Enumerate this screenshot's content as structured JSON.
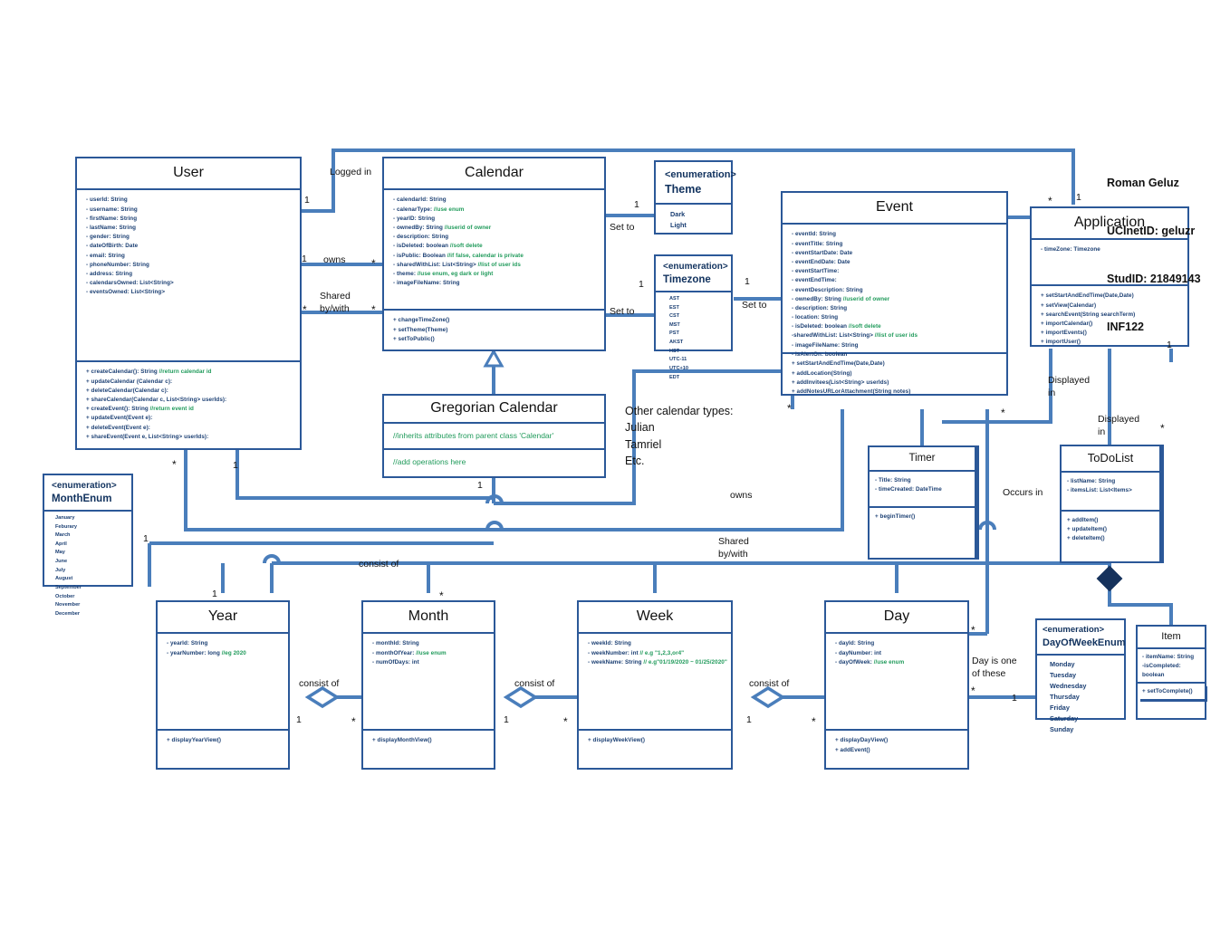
{
  "author": {
    "name": "Roman Geluz",
    "ucinetid": "UCInetID: geluzr",
    "studid": "StudID: 21849143",
    "course": "INF122"
  },
  "classes": {
    "user": {
      "name": "User",
      "attributes": [
        {
          "text": "- userId: String"
        },
        {
          "text": "- username: String"
        },
        {
          "text": "- firstName: String"
        },
        {
          "text": "- lastName: String"
        },
        {
          "text": "- gender: String"
        },
        {
          "text": "- dateOfBirth: Date"
        },
        {
          "text": "- email: String"
        },
        {
          "text": "- phoneNumber: String"
        },
        {
          "text": "- address: String"
        },
        {
          "text": "- calendarsOwned: List<String>"
        },
        {
          "text": "- eventsOwned: List<String>"
        }
      ],
      "operations": [
        {
          "text": "+ createCalendar(): String ",
          "comment": "//return calendar id"
        },
        {
          "text": "+ updateCalendar (Calendar c):",
          "comment": ""
        },
        {
          "text": "+ deleteCalendar(Calendar c):",
          "comment": ""
        },
        {
          "text": "+ shareCalendar(Calendar c, List<String> userIds):",
          "comment": ""
        },
        {
          "text": "+ createEvent(): String ",
          "comment": "//return event id"
        },
        {
          "text": "+ updateEvent(Event e):",
          "comment": ""
        },
        {
          "text": "+ deleteEvent(Event e):",
          "comment": ""
        },
        {
          "text": "+ shareEvent(Event e, List<String> userIds):",
          "comment": ""
        }
      ]
    },
    "calendar": {
      "name": "Calendar",
      "attributes": [
        {
          "text": "- calendarId: String",
          "comment": ""
        },
        {
          "text": "- calenarType: ",
          "comment": "//use enum"
        },
        {
          "text": "- yearID: String",
          "comment": ""
        },
        {
          "text": "- ownedBy: String ",
          "comment": "//userid of owner"
        },
        {
          "text": "- description: String",
          "comment": ""
        },
        {
          "text": "- isDeleted: boolean ",
          "comment": "//soft delete"
        },
        {
          "text": "- isPublic: Boolean ",
          "comment": "//if false, calendar is private"
        },
        {
          "text": "- sharedWithList: List<String> ",
          "comment": "//list of user ids"
        },
        {
          "text": "- theme: ",
          "comment": "//use enum, eg dark or light"
        },
        {
          "text": "- imageFileName: String",
          "comment": ""
        }
      ],
      "operations": [
        {
          "text": "+ changeTimeZone()",
          "comment": ""
        },
        {
          "text": "+ setTheme(Theme)",
          "comment": ""
        },
        {
          "text": "+ setToPublic()",
          "comment": ""
        }
      ]
    },
    "gregorian_calendar": {
      "name": "Gregorian Calendar",
      "attributes_note": "//inherits attributes from parent class 'Calendar'",
      "operations_note": "//add operations here"
    },
    "event": {
      "name": "Event",
      "attributes": [
        {
          "text": "- eventId: String",
          "comment": ""
        },
        {
          "text": "- eventTitle: String",
          "comment": ""
        },
        {
          "text": "- eventStartDate: Date",
          "comment": ""
        },
        {
          "text": "- eventEndDate: Date",
          "comment": ""
        },
        {
          "text": "- eventStartTime:",
          "comment": ""
        },
        {
          "text": "- eventEndTime:",
          "comment": ""
        },
        {
          "text": "- eventDescription: String",
          "comment": ""
        },
        {
          "text": "- ownedBy: String ",
          "comment": "//userid of owner"
        },
        {
          "text": "- description: String",
          "comment": ""
        },
        {
          "text": "- location: String",
          "comment": ""
        },
        {
          "text": "- isDeleted: boolean ",
          "comment": "//soft delete"
        },
        {
          "text": "-sharedWithList: List<String> ",
          "comment": "//list of user ids"
        },
        {
          "text": "- imageFileName: String",
          "comment": ""
        },
        {
          "text": "- isAlertOn: boolean",
          "comment": ""
        }
      ],
      "operations": [
        {
          "text": "+ setStartAndEndTime(Date,Date)",
          "comment": ""
        },
        {
          "text": "+ addLocation(String)",
          "comment": ""
        },
        {
          "text": "+ addInvitees(List<String> userIds)",
          "comment": ""
        },
        {
          "text": "+ addNotesURLorAttachment(String notes)",
          "comment": ""
        }
      ]
    },
    "application": {
      "name": "Application",
      "attributes": [
        {
          "text": "- timeZone: Timezone",
          "comment": ""
        }
      ],
      "operations": [
        {
          "text": "+ setStartAndEndTime(Date,Date)",
          "comment": ""
        },
        {
          "text": "+ setView(Calendar)",
          "comment": ""
        },
        {
          "text": "+ searchEvent(String searchTerm)",
          "comment": ""
        },
        {
          "text": "+ importCalendar()",
          "comment": ""
        },
        {
          "text": "+ importEvents()",
          "comment": ""
        },
        {
          "text": "+ importUser()",
          "comment": ""
        }
      ]
    },
    "timer": {
      "name": "Timer",
      "attributes": [
        {
          "text": "- Title: String",
          "comment": ""
        },
        {
          "text": "- timeCreated: DateTime",
          "comment": ""
        }
      ],
      "operations": [
        {
          "text": "+ beginTimer()",
          "comment": ""
        }
      ]
    },
    "todolist": {
      "name": "ToDoList",
      "attributes": [
        {
          "text": "- listName: String",
          "comment": ""
        },
        {
          "text": "- itemsList: List<Items>",
          "comment": ""
        }
      ],
      "operations": [
        {
          "text": "+ addItem()",
          "comment": ""
        },
        {
          "text": "+ updateItem()",
          "comment": ""
        },
        {
          "text": "+ deleteItem()",
          "comment": ""
        }
      ]
    },
    "item": {
      "name": "Item",
      "attributes": [
        {
          "text": "- itemName: String",
          "comment": ""
        },
        {
          "text": "-isCompleted:",
          "comment": ""
        },
        {
          "text": "boolean",
          "comment": ""
        }
      ],
      "operations": [
        {
          "text": "+ setToComplete()",
          "comment": ""
        }
      ]
    },
    "year": {
      "name": "Year",
      "attributes": [
        {
          "text": "- yearId: String",
          "comment": ""
        },
        {
          "text": "- yearNumber: long ",
          "comment": "//eg 2020"
        }
      ],
      "operations": [
        {
          "text": "+ displayYearView()",
          "comment": ""
        }
      ]
    },
    "month": {
      "name": "Month",
      "attributes": [
        {
          "text": "- monthId: String",
          "comment": ""
        },
        {
          "text": "- monthOfYear: ",
          "comment": "//use enum"
        },
        {
          "text": "- numOfDays: int",
          "comment": ""
        }
      ],
      "operations": [
        {
          "text": "+ displayMonthView()",
          "comment": ""
        }
      ]
    },
    "week": {
      "name": "Week",
      "attributes": [
        {
          "text": "- weekId: String",
          "comment": ""
        },
        {
          "text": "- weekNumber: int ",
          "comment": "// e.g \"1,2,3,or4\""
        },
        {
          "text": "- weekName: String ",
          "comment": "// e.g\"01/19/2020 ~ 01/25/2020\""
        }
      ],
      "operations": [
        {
          "text": "+ displayWeekView()",
          "comment": ""
        }
      ]
    },
    "day": {
      "name": "Day",
      "attributes": [
        {
          "text": "- dayId: String",
          "comment": ""
        },
        {
          "text": "- dayNumber: int",
          "comment": ""
        },
        {
          "text": "- dayOfWeek: ",
          "comment": "//use enum"
        }
      ],
      "operations": [
        {
          "text": "+ displayDayView()",
          "comment": ""
        },
        {
          "text": "+ addEvent()",
          "comment": ""
        }
      ]
    }
  },
  "enums": {
    "theme": {
      "stereotype": "<enumeration>",
      "name": "Theme",
      "values": [
        "Dark",
        "Light"
      ]
    },
    "timezone": {
      "stereotype": "<enumeration>",
      "name": "Timezone",
      "values": [
        "AST",
        "EST",
        "CST",
        "MST",
        "PST",
        "AKST",
        "HST",
        "UTC-11",
        "UTC+10",
        "EDT"
      ]
    },
    "month_enum": {
      "stereotype": "<enumeration>",
      "name": "MonthEnum",
      "values": [
        "January",
        "Feburary",
        "March",
        "April",
        "May",
        "June",
        "July",
        "August",
        "September",
        "October",
        "November",
        "December"
      ]
    },
    "day_of_week_enum": {
      "stereotype": "<enumeration>",
      "name": "DayOfWeekEnum",
      "values": [
        "Monday",
        "Tuesday",
        "Wednesday",
        "Thursday",
        "Friday",
        "Saturday",
        "Sunday"
      ]
    }
  },
  "labels": {
    "logged_in": "Logged in",
    "owns": "owns",
    "shared_by_with": "Shared\nby/with",
    "set_to_theme": "Set to",
    "set_to_timezone_left": "Set to",
    "set_to_timezone_right": "Set to",
    "owns_right": "owns",
    "shared_by_with_right": "Shared\nby/with",
    "displayed_in_1": "Displayed\nin",
    "displayed_in_2": "Displayed\nin",
    "occurs_in": "Occurs in",
    "day_is_one_of_these": "Day is one\nof these",
    "consist_of_year_month": "consist of",
    "consist_of_month_week": "consist of",
    "consist_of_week_day": "consist of",
    "consist_of_top": "consist of",
    "other_calendar_types": "Other calendar types:\nJulian\nTamriel\nEtc."
  },
  "multiplicities": {
    "user_logged_in": "1",
    "user_owns": "1",
    "calendar_owns_many": "*",
    "user_shared_many": "*",
    "calendar_shared_many": "*",
    "calendar_theme": "1",
    "calendar_tz": "1",
    "event_tz": "1",
    "app_star": "*",
    "app_one": "1",
    "gregorian_one": "1",
    "user_bottom_star": "*",
    "user_bottom_one": "1",
    "monthenum_one": "1",
    "year_one_top": "1",
    "year_one": "1",
    "month_star": "*",
    "month_one": "1",
    "week_star": "*",
    "week_one": "1",
    "day_star": "*",
    "day_star2": "*",
    "day_one": "1",
    "event_star1": "*",
    "event_star2": "*",
    "app_bottom_one": "1",
    "todolist_star": "*",
    "timer_star": "*"
  },
  "colors": {
    "line": "#4a7ebb",
    "border": "#2b5898",
    "member_text": "#1b3f73",
    "comment_text": "#1f9a5a",
    "diamond_fill": "#ffffff",
    "filled_diamond": "#16325c"
  }
}
